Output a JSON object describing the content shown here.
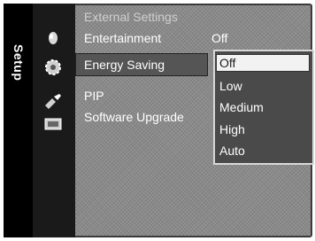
{
  "sidebar": {
    "title": "Setup"
  },
  "icons": [
    "pointer-icon",
    "gear-icon",
    "satellite-icon",
    "support-icon"
  ],
  "menu": {
    "items": [
      {
        "label": "External Settings",
        "value": ""
      },
      {
        "label": "Entertainment",
        "value": "Off"
      },
      {
        "label": "Energy Saving",
        "value": ""
      },
      {
        "label": "PIP",
        "value": ""
      },
      {
        "label": "Software Upgrade",
        "value": ""
      }
    ],
    "selected_index": 2
  },
  "dropdown": {
    "options": [
      "Off",
      "Low",
      "Medium",
      "High",
      "Auto"
    ],
    "selected": "Off"
  },
  "colors": {
    "background": "#8a8a8a",
    "sidebar": "#000000",
    "dropdown_bg": "#4a4a4a",
    "selected_option": "#f2f2f2"
  }
}
